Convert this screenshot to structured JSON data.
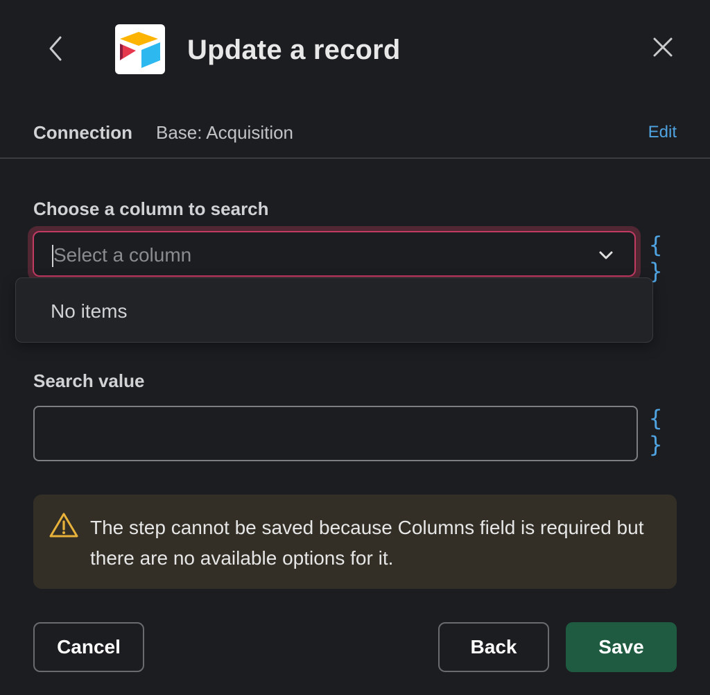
{
  "header": {
    "title": "Update a record",
    "app_logo_icon": "airtable-logo-icon",
    "back_icon": "chevron-left-icon",
    "close_icon": "close-icon"
  },
  "connection": {
    "label": "Connection",
    "value": "Base: Acquisition",
    "edit_label": "Edit"
  },
  "column_field": {
    "label": "Choose a column to search",
    "placeholder": "Select a column",
    "chevron_icon": "chevron-down-icon",
    "variables_icon": "curly-braces-icon",
    "variables_text": "{ }",
    "dropdown": {
      "empty_text": "No items"
    }
  },
  "search_field": {
    "label": "Search value",
    "value": "",
    "variables_icon": "curly-braces-icon",
    "variables_text": "{ }"
  },
  "warning": {
    "icon": "warning-triangle-icon",
    "text": "The step cannot be saved because Columns field is required but there are no available options for it."
  },
  "footer": {
    "cancel_label": "Cancel",
    "back_label": "Back",
    "save_label": "Save"
  },
  "colors": {
    "background": "#1c1d21",
    "accent_link": "#4fa3e0",
    "error_border": "#c13b63",
    "warning_bg": "#332f26",
    "warning_icon": "#e8b23a",
    "save_button": "#1f5b41"
  }
}
